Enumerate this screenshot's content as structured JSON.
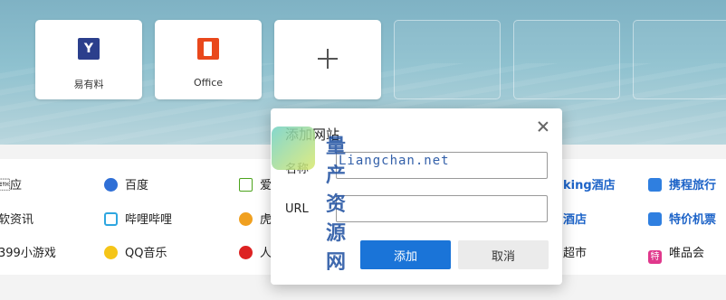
{
  "tiles": [
    {
      "label": "易有料",
      "icon": "yiyouliao-logo-icon",
      "glyph": "Y"
    },
    {
      "label": "Office",
      "icon": "office-logo-icon"
    },
    {
      "label": "",
      "icon": "plus-icon"
    }
  ],
  "links": {
    "col1": [
      "\u0003应",
      "软资讯",
      "399小游戏"
    ],
    "col2": [
      "百度",
      "哔哩哔哩",
      "QQ音乐"
    ],
    "col3": [
      "爱",
      "虎",
      "人"
    ],
    "col4": [
      "king酒店",
      "酒店",
      "超市"
    ],
    "col5": [
      "携程旅行",
      "特价机票",
      "唯品会"
    ]
  },
  "dialog": {
    "title": "添加网站",
    "name_label": "名称",
    "name_value": "",
    "url_label": "URL",
    "url_value": "",
    "add_button": "添加",
    "cancel_button": "取消"
  },
  "watermark": {
    "text": "量产资源网",
    "url": "Liangchan.net"
  },
  "colors": {
    "accent": "#1a74d8",
    "link_blue": "#1e64c8"
  }
}
